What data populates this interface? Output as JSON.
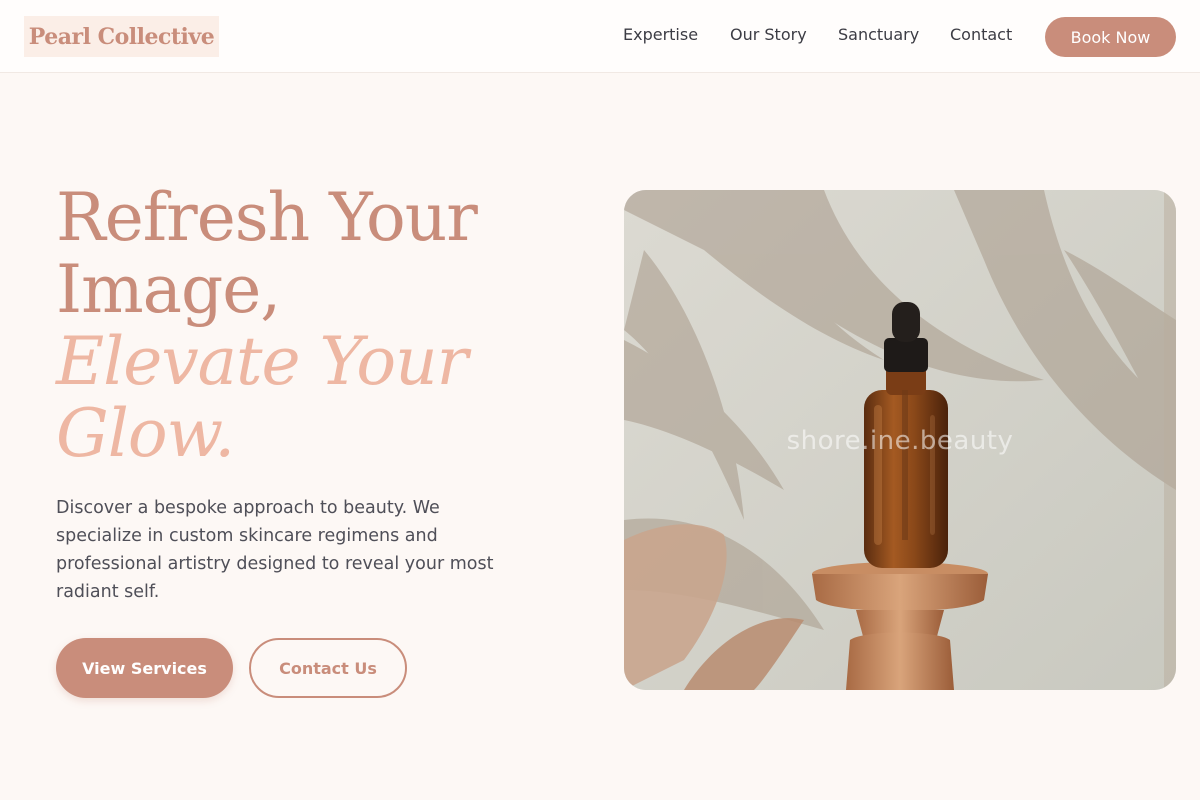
{
  "brand": {
    "name": "Pearl Collective"
  },
  "nav": {
    "items": [
      {
        "label": "Expertise"
      },
      {
        "label": "Our Story"
      },
      {
        "label": "Sanctuary"
      },
      {
        "label": "Contact"
      }
    ],
    "cta_label": "Book Now"
  },
  "hero": {
    "title_line1": "Refresh Your",
    "title_line2": "Image,",
    "title_line3": "Elevate Your",
    "title_line4": "Glow.",
    "description": "Discover a bespoke approach to beauty. We specialize in custom skincare regimens and professional artistry designed to reveal your most radiant self.",
    "primary_button": "View Services",
    "secondary_button": "Contact Us",
    "image_watermark": "shore.ine.beauty",
    "image_icon": "serum-dropper-bottle-photo"
  },
  "colors": {
    "accent": "#c98d7b",
    "accent_light": "#eeb7a3",
    "background": "#fdf8f5",
    "logo_bg": "#fbeee7"
  }
}
